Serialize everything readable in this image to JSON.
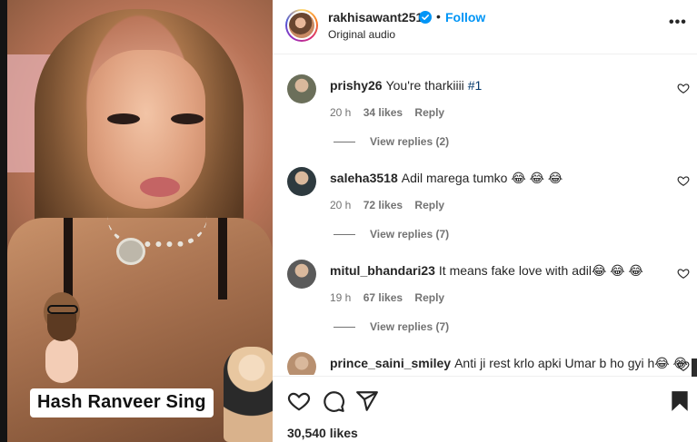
{
  "media": {
    "caption": "Hash Ranveer Sing"
  },
  "header": {
    "username": "rakhisawant2511",
    "dot": "•",
    "follow_label": "Follow",
    "audio": "Original audio",
    "more_label": "•••"
  },
  "comments": [
    {
      "username": "prishy26",
      "text": "You're tharkiiii ",
      "tag": "#1",
      "time": "20 h",
      "likes": "34 likes",
      "reply_label": "Reply",
      "view_replies": "View replies (2)",
      "avatar_color": "#6b6f5a"
    },
    {
      "username": "saleha3518",
      "text": "Adil marega tumko 😂 😂 😂",
      "tag": "",
      "time": "20 h",
      "likes": "72 likes",
      "reply_label": "Reply",
      "view_replies": "View replies (7)",
      "avatar_color": "#2e3a3f"
    },
    {
      "username": "mitul_bhandari23",
      "text": "It means fake love with adil😂 😂 😂",
      "tag": "",
      "time": "19 h",
      "likes": "67 likes",
      "reply_label": "Reply",
      "view_replies": "View replies (7)",
      "avatar_color": "#5a5a5a"
    },
    {
      "username": "prince_saini_smiley",
      "text": "Anti ji rest krlo apki Umar b ho gyi h😂 😂",
      "tag": "",
      "avatar_color": "#b89070"
    }
  ],
  "footer": {
    "likes": "30,540 likes"
  },
  "colors": {
    "link_blue": "#0095f6",
    "text_primary": "#262626",
    "text_secondary": "#737373"
  }
}
